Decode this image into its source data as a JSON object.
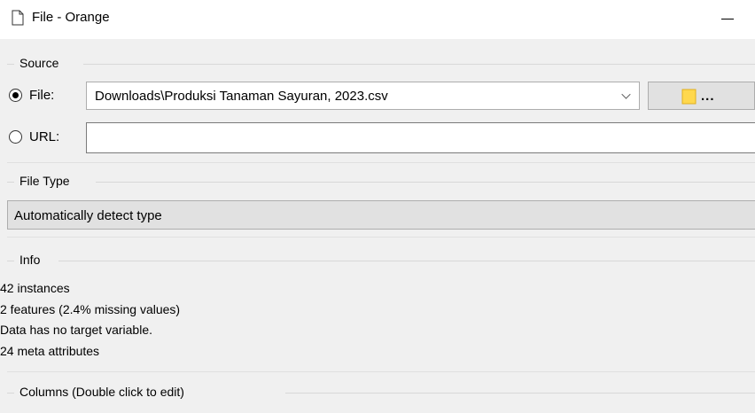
{
  "window": {
    "title": "File - Orange",
    "minimize_icon": "minimize-icon"
  },
  "source": {
    "group_title": "Source",
    "file_radio_label": "File:",
    "file_selected": true,
    "file_path": "Downloads\\Produksi Tanaman Sayuran, 2023.csv",
    "browse_label": "...",
    "browse_icon": "folder-icon",
    "url_radio_label": "URL:",
    "url_value": ""
  },
  "file_type": {
    "group_title": "File Type",
    "selected": "Automatically detect type"
  },
  "info": {
    "group_title": "Info",
    "lines": [
      "42 instances",
      "2 features (2.4% missing values)",
      "Data has no target variable.",
      "24 meta attributes"
    ]
  },
  "columns": {
    "group_title": "Columns (Double click to edit)"
  },
  "colors": {
    "window_bg": "#f0f0f0",
    "folder_yellow": "#ffd84d"
  }
}
